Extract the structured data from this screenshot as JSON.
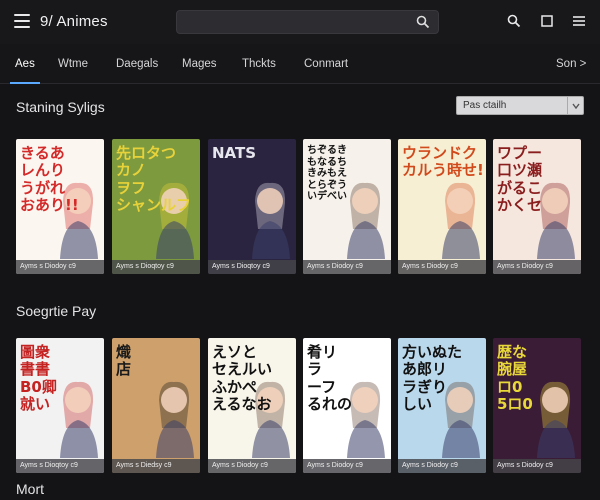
{
  "header": {
    "title": "9/ Animes",
    "search_placeholder": ""
  },
  "tabs": [
    {
      "label": "Aes",
      "active": true
    },
    {
      "label": "Wtme"
    },
    {
      "label": "Daegals"
    },
    {
      "label": "Mages"
    },
    {
      "label": "Thckts"
    },
    {
      "label": "Conmart"
    }
  ],
  "tabs_right": "Son >",
  "sections": [
    {
      "title": "Staning Syligs",
      "sort_label": "Pas ctailh"
    },
    {
      "title": "Soegrtie Pay"
    },
    {
      "title": "Mort"
    }
  ],
  "row1": [
    {
      "cover": "きるあ\nレんり\nうがれ\nおあり!!",
      "caption": "Ayms s Diodoy c9",
      "color": "#d42a2a",
      "bg": "#fbf6ef"
    },
    {
      "cover": "先ロタつ\nカノ\nヲフ\nシャンルフ",
      "caption": "Ayms s Dioqtoy c9",
      "color": "#e8d23a",
      "bg": "#7d9a3e"
    },
    {
      "cover": "NATS",
      "caption": "Ayms s Dioqtoy c9",
      "color": "#e6e6ee",
      "bg": "#2b2440"
    },
    {
      "cover": "ちぞるき\nもなるち\nきみもえ\nとらぞう\nいデべい",
      "caption": "Ayms s Diodoy c9",
      "color": "#111",
      "bg": "#f6f1ea"
    },
    {
      "cover": "ウランドク\nカルう時せ!",
      "caption": "Ayms s Diodoy c9",
      "color": "#d14a1c",
      "bg": "#f7efd4"
    },
    {
      "cover": "ワプー\n口ツ瀬\nがるこ\nかくセ",
      "caption": "Ayms s Diodoy c9",
      "color": "#8a1d1d",
      "bg": "#f5e6de"
    }
  ],
  "row2": [
    {
      "cover": "圖衆\n書書\nB0卿\n就い",
      "caption": "Ayms s Dioqtoy c9",
      "color": "#c52222",
      "bg": "#f2f2f2"
    },
    {
      "cover": "熾\n店",
      "caption": "Ayms s Diedsy c9",
      "color": "#1a1a1a",
      "bg": "#cda06c"
    },
    {
      "cover": "えソと\nセえルい\nふかぺ\nえるなお",
      "caption": "Ayms s Diodoy c9",
      "color": "#111",
      "bg": "#f8f5ea"
    },
    {
      "cover": "肴リ\nラ\nーフ\nるれの",
      "caption": "Ayms s Diodoy c9",
      "color": "#111",
      "bg": "#ffffff"
    },
    {
      "cover": "方いぬた\nあ郎リ\nラぎり\nしい",
      "caption": "Ayms s Diodoy c9",
      "color": "#111",
      "bg": "#b9d8ec"
    },
    {
      "cover": "歴な\n腕屋\nロ0\n5ロ0",
      "caption": "Ayms s Diodoy c9",
      "color": "#e8d83a",
      "bg": "#3b1c36"
    }
  ],
  "colors": {
    "accent": "#5aa9ff",
    "background": "#141416"
  },
  "icons": [
    "menu-icon",
    "search-icon",
    "search-icon-header",
    "square-icon",
    "hamburger-icon",
    "sort-chevron-icon"
  ]
}
